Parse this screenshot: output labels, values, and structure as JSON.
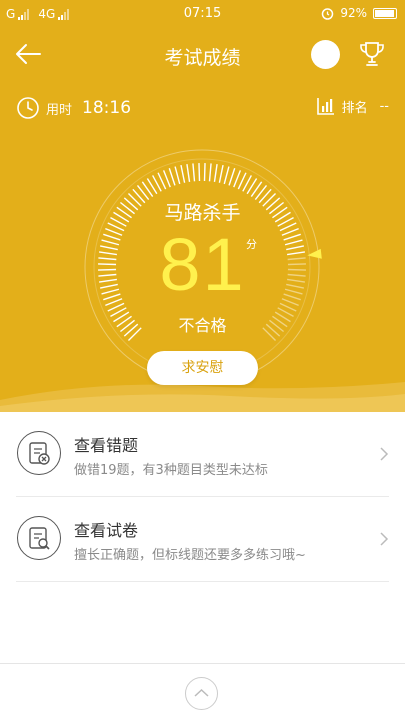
{
  "status_bar": {
    "carrier1": "G",
    "carrier2": "4G",
    "time": "07:15",
    "battery": "92%"
  },
  "header": {
    "title": "考试成绩"
  },
  "stats": {
    "time_label": "用时",
    "time_value": "18:16",
    "rank_label": "排名",
    "rank_value": "--"
  },
  "score": {
    "nickname": "马路杀手",
    "value": "81",
    "unit": "分",
    "result": "不合格",
    "level": 0.81
  },
  "comfort_button": "求安慰",
  "list": [
    {
      "title": "查看错题",
      "subtitle": "做错19题，有3种题目类型未达标",
      "icon": "wrong-questions-icon"
    },
    {
      "title": "查看试卷",
      "subtitle": "擅长正确题，但标线题还要多多练习哦~",
      "icon": "exam-paper-icon"
    }
  ],
  "colors": {
    "primary": "#e3af1a",
    "score": "#fff14d",
    "button_text": "#d9a20f"
  }
}
